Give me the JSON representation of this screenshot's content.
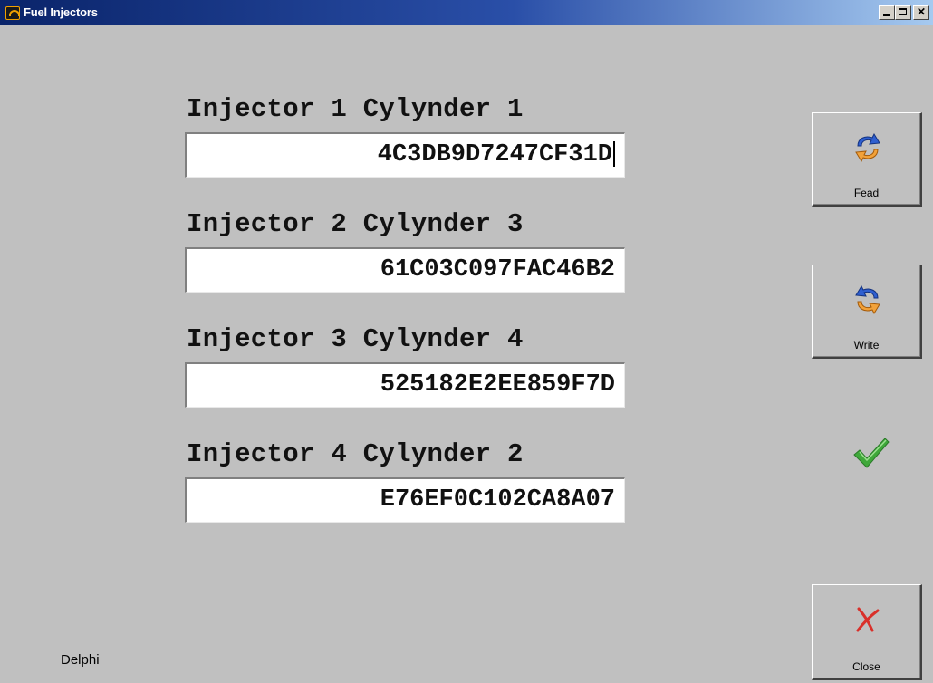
{
  "window": {
    "title": "Fuel Injectors",
    "icon": "app-logo-icon"
  },
  "injectors": [
    {
      "label": "Injector 1 Cylynder 1",
      "code": "4C3DB9D7247CF31D"
    },
    {
      "label": "Injector 2 Cylynder 3",
      "code": "61C03C097FAC46B2"
    },
    {
      "label": "Injector 3 Cylynder 4",
      "code": "525182E2EE859F7D"
    },
    {
      "label": "Injector 4 Cylynder 2",
      "code": "E76EF0C102CA8A07"
    }
  ],
  "buttons": {
    "read": "Fead",
    "write": "Write",
    "close": "Close"
  },
  "status_icon": "checkmark-icon",
  "colors": {
    "titlebar_start": "#0a246a",
    "titlebar_end": "#a6caf0",
    "background": "#c0c0c0",
    "check": "#3fa83a",
    "close_x": "#d9302a"
  },
  "footer": {
    "brand": "Delphi"
  }
}
